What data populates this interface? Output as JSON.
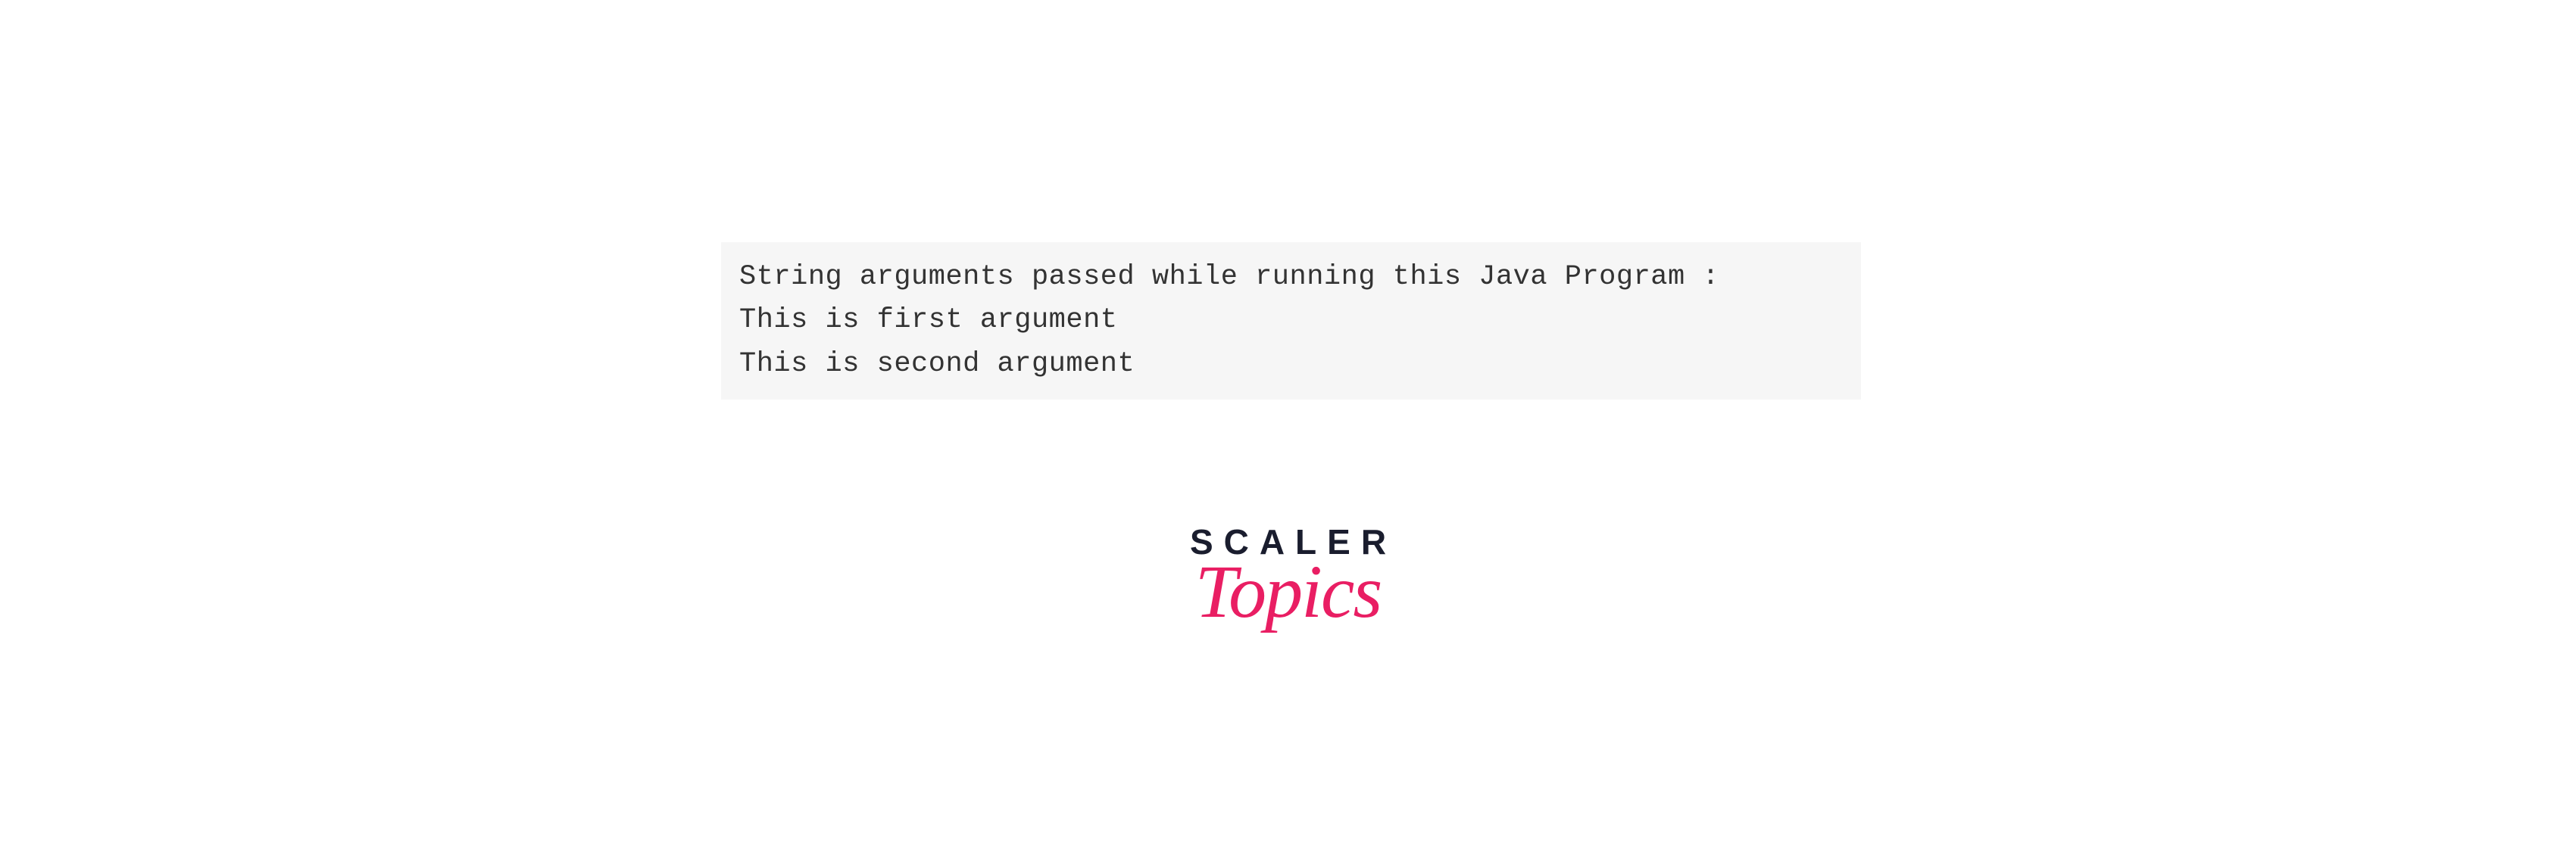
{
  "code": {
    "line1": "String arguments passed while running this Java Program :",
    "line2": "This is first argument",
    "line3": "This is second argument"
  },
  "logo": {
    "brand": "SCALER",
    "subbrand": "Topics"
  }
}
